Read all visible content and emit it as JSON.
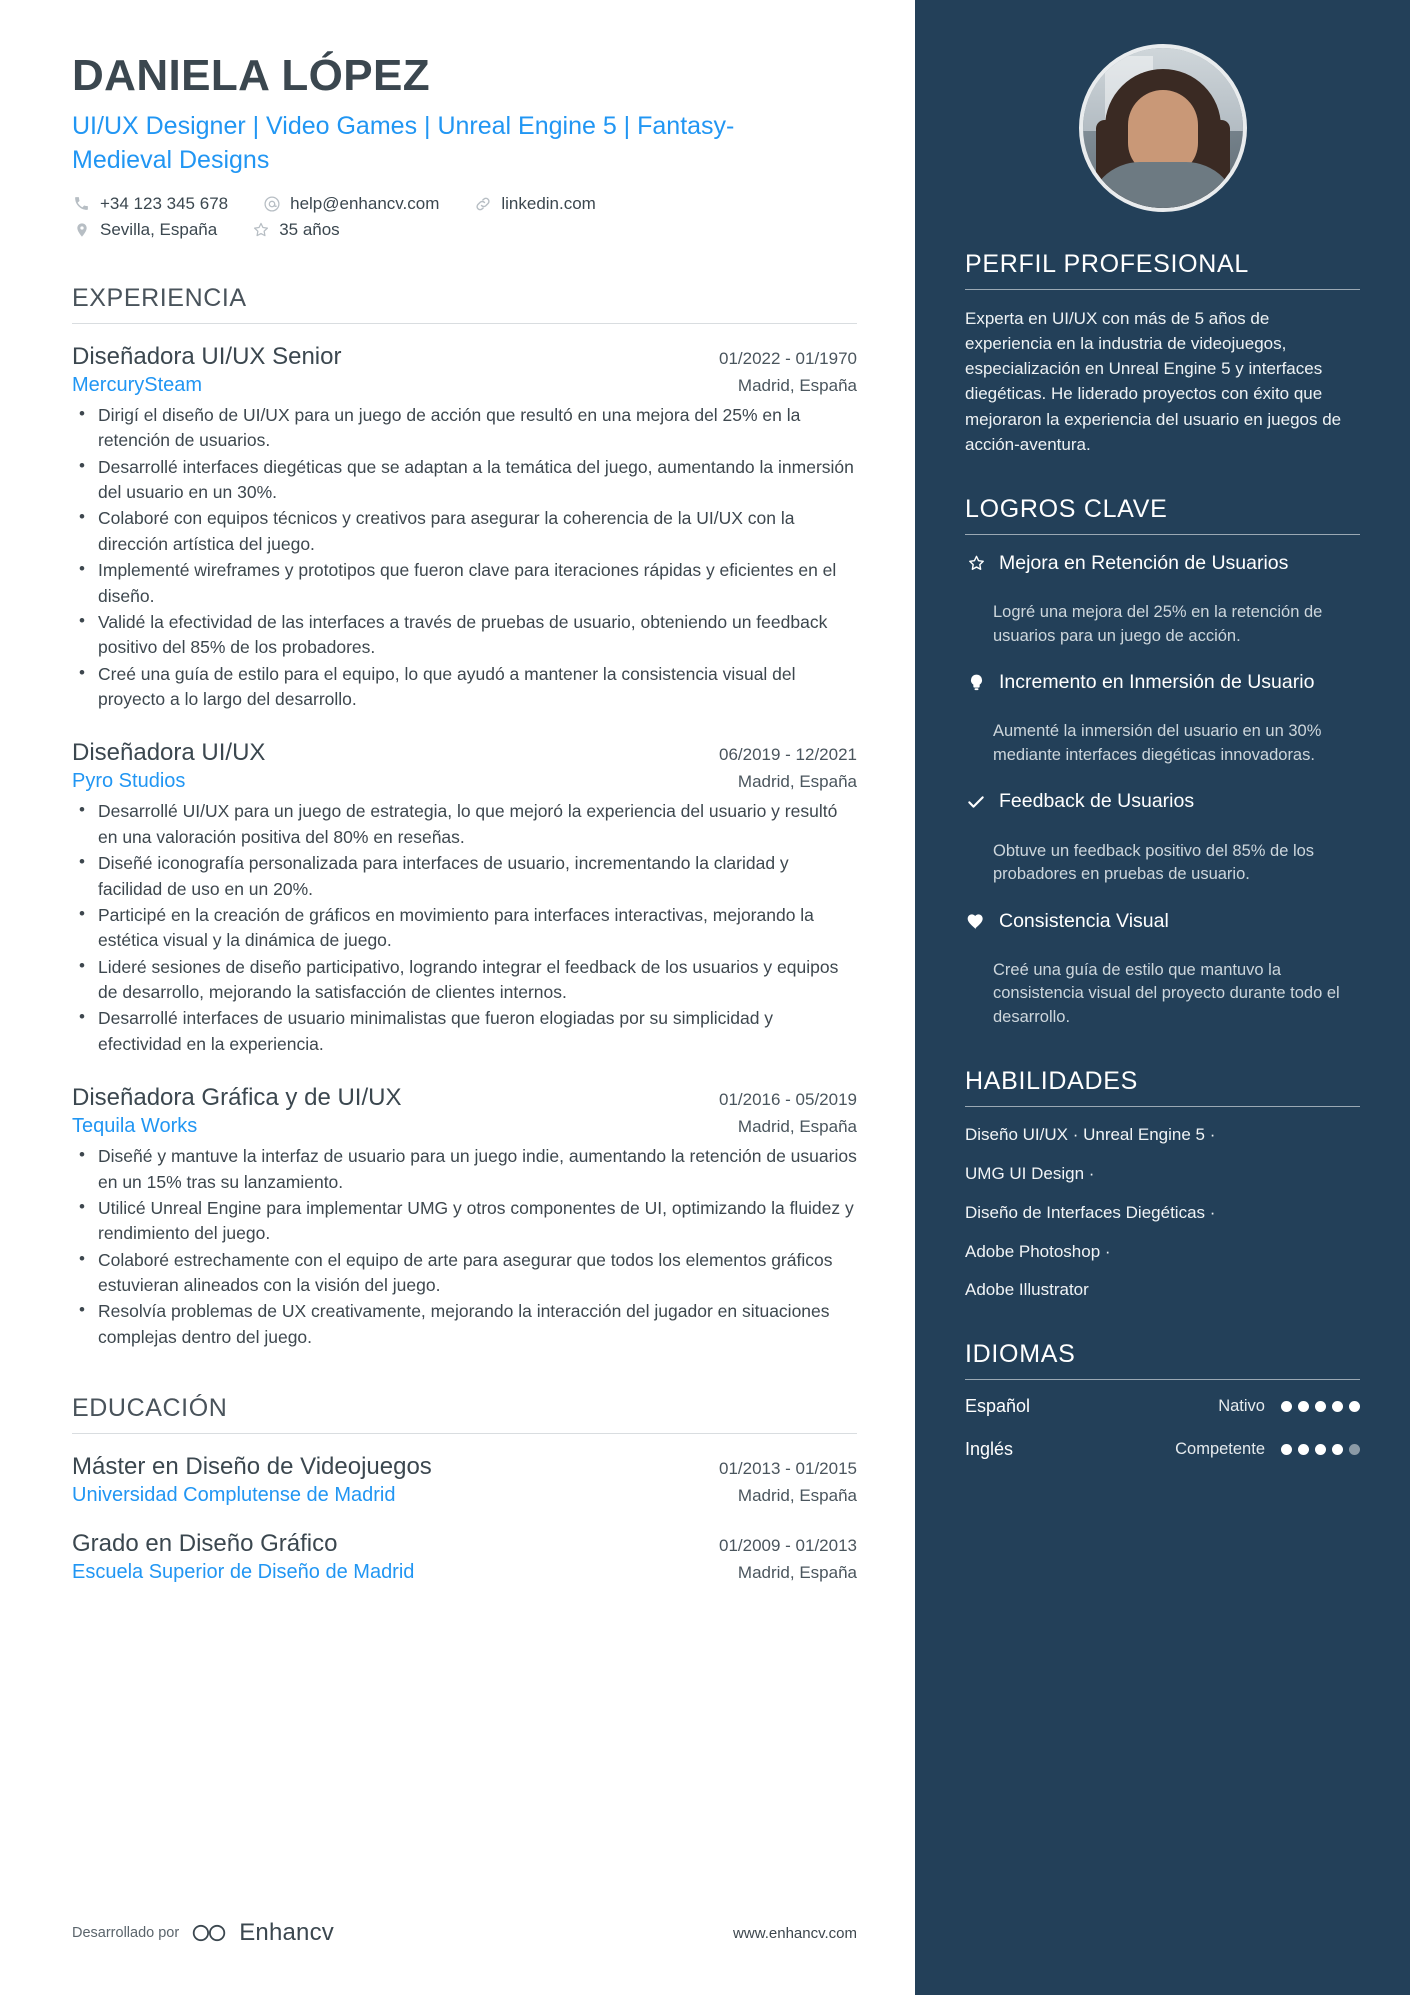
{
  "header": {
    "name": "DANIELA LÓPEZ",
    "headline": "UI/UX Designer | Video Games | Unreal Engine 5 | Fantasy-Medieval Designs",
    "contacts": [
      {
        "icon": "phone-icon",
        "text": "+34 123 345 678"
      },
      {
        "icon": "email-icon",
        "text": "help@enhancv.com"
      },
      {
        "icon": "link-icon",
        "text": "linkedin.com"
      }
    ],
    "contacts2": [
      {
        "icon": "location-pin-icon",
        "text": "Sevilla, España"
      },
      {
        "icon": "star-icon",
        "text": "35 años"
      }
    ]
  },
  "experience": {
    "title": "EXPERIENCIA",
    "entries": [
      {
        "role": "Diseñadora UI/UX Senior",
        "dates": "01/2022 - 01/1970",
        "company": "MercurySteam",
        "location": "Madrid, España",
        "bullets": [
          "Dirigí el diseño de UI/UX para un juego de acción que resultó en una mejora del 25% en la retención de usuarios.",
          "Desarrollé interfaces diegéticas que se adaptan a la temática del juego, aumentando la inmersión del usuario en un 30%.",
          "Colaboré con equipos técnicos y creativos para asegurar la coherencia de la UI/UX con la dirección artística del juego.",
          "Implementé wireframes y prototipos que fueron clave para iteraciones rápidas y eficientes en el diseño.",
          "Validé la efectividad de las interfaces a través de pruebas de usuario, obteniendo un feedback positivo del 85% de los probadores.",
          "Creé una guía de estilo para el equipo, lo que ayudó a mantener la consistencia visual del proyecto a lo largo del desarrollo."
        ]
      },
      {
        "role": "Diseñadora UI/UX",
        "dates": "06/2019 - 12/2021",
        "company": "Pyro Studios",
        "location": "Madrid, España",
        "bullets": [
          "Desarrollé UI/UX para un juego de estrategia, lo que mejoró la experiencia del usuario y resultó en una valoración positiva del 80% en reseñas.",
          "Diseñé iconografía personalizada para interfaces de usuario, incrementando la claridad y facilidad de uso en un 20%.",
          "Participé en la creación de gráficos en movimiento para interfaces interactivas, mejorando la estética visual y la dinámica de juego.",
          "Lideré sesiones de diseño participativo, logrando integrar el feedback de los usuarios y equipos de desarrollo, mejorando la satisfacción de clientes internos.",
          "Desarrollé interfaces de usuario minimalistas que fueron elogiadas por su simplicidad y efectividad en la experiencia."
        ]
      },
      {
        "role": "Diseñadora Gráfica y de UI/UX",
        "dates": "01/2016 - 05/2019",
        "company": "Tequila Works",
        "location": "Madrid, España",
        "bullets": [
          "Diseñé y mantuve la interfaz de usuario para un juego indie, aumentando la retención de usuarios en un 15% tras su lanzamiento.",
          "Utilicé Unreal Engine para implementar UMG y otros componentes de UI, optimizando la fluidez y rendimiento del juego.",
          "Colaboré estrechamente con el equipo de arte para asegurar que todos los elementos gráficos estuvieran alineados con la visión del juego.",
          "Resolvía problemas de UX creativamente, mejorando la interacción del jugador en situaciones complejas dentro del juego."
        ]
      }
    ]
  },
  "education": {
    "title": "EDUCACIÓN",
    "entries": [
      {
        "degree": "Máster en Diseño de Videojuegos",
        "dates": "01/2013 - 01/2015",
        "school": "Universidad Complutense de Madrid",
        "location": "Madrid, España"
      },
      {
        "degree": "Grado en Diseño Gráfico",
        "dates": "01/2009 - 01/2013",
        "school": "Escuela Superior de Diseño de Madrid",
        "location": "Madrid, España"
      }
    ]
  },
  "footer": {
    "developed_by": "Desarrollado por",
    "brand": "Enhancv",
    "url": "www.enhancv.com"
  },
  "profile": {
    "title": "PERFIL PROFESIONAL",
    "text": "Experta en UI/UX con más de 5 años de experiencia en la industria de videojuegos, especialización en Unreal Engine 5 y interfaces diegéticas. He liderado proyectos con éxito que mejoraron la experiencia del usuario en juegos de acción-aventura."
  },
  "achievements": {
    "title": "LOGROS CLAVE",
    "items": [
      {
        "icon": "star-outline-icon",
        "title": "Mejora en Retención de Usuarios",
        "desc": "Logré una mejora del 25% en la retención de usuarios para un juego de acción."
      },
      {
        "icon": "lightbulb-icon",
        "title": "Incremento en Inmersión de Usuario",
        "desc": "Aumenté la inmersión del usuario en un 30% mediante interfaces diegéticas innovadoras."
      },
      {
        "icon": "check-icon",
        "title": "Feedback de Usuarios",
        "desc": "Obtuve un feedback positivo del 85% de los probadores en pruebas de usuario."
      },
      {
        "icon": "heart-icon",
        "title": "Consistencia Visual",
        "desc": "Creé una guía de estilo que mantuvo la consistencia visual del proyecto durante todo el desarrollo."
      }
    ]
  },
  "skills": {
    "title": "HABILIDADES",
    "lines": [
      "Diseño UI/UX · Unreal Engine 5 ·",
      "UMG UI Design ·",
      "Diseño de Interfaces Diegéticas ·",
      "Adobe Photoshop ·",
      "Adobe Illustrator"
    ]
  },
  "languages": {
    "title": "IDIOMAS",
    "items": [
      {
        "name": "Español",
        "level": "Nativo",
        "filled": 5,
        "total": 5
      },
      {
        "name": "Inglés",
        "level": "Competente",
        "filled": 4,
        "total": 5
      }
    ]
  },
  "colors": {
    "accent_blue": "#2196f3",
    "sidebar_bg": "#234059",
    "text_dark": "#3b474f"
  }
}
